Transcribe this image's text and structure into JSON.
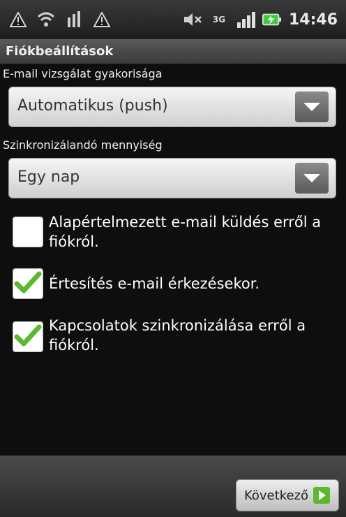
{
  "status_bar": {
    "time": "14:46",
    "network_label": "3G",
    "icons": [
      "warning-icon",
      "wifi-question-icon",
      "sim-icon",
      "warning-icon",
      "mute-icon",
      "network-3g-icon",
      "signal-icon",
      "battery-icon"
    ]
  },
  "title": "Fiókbeállítások",
  "sections": [
    {
      "label": "E-mail vizsgálat gyakorisága",
      "selected": "Automatikus (push)"
    },
    {
      "label": "Szinkronizálandó mennyiség",
      "selected": "Egy nap"
    }
  ],
  "checkboxes": [
    {
      "label": "Alapértelmezett e-mail küldés erről a fiókról.",
      "checked": false
    },
    {
      "label": "Értesítés e-mail érkezésekor.",
      "checked": true
    },
    {
      "label": "Kapcsolatok szinkronizálása erről a fiókról.",
      "checked": true
    }
  ],
  "buttons": {
    "next": "Következő"
  },
  "colors": {
    "check_green": "#5cb82e",
    "battery_green": "#3ccc3c",
    "warning_yellow": "#f2c21b"
  }
}
